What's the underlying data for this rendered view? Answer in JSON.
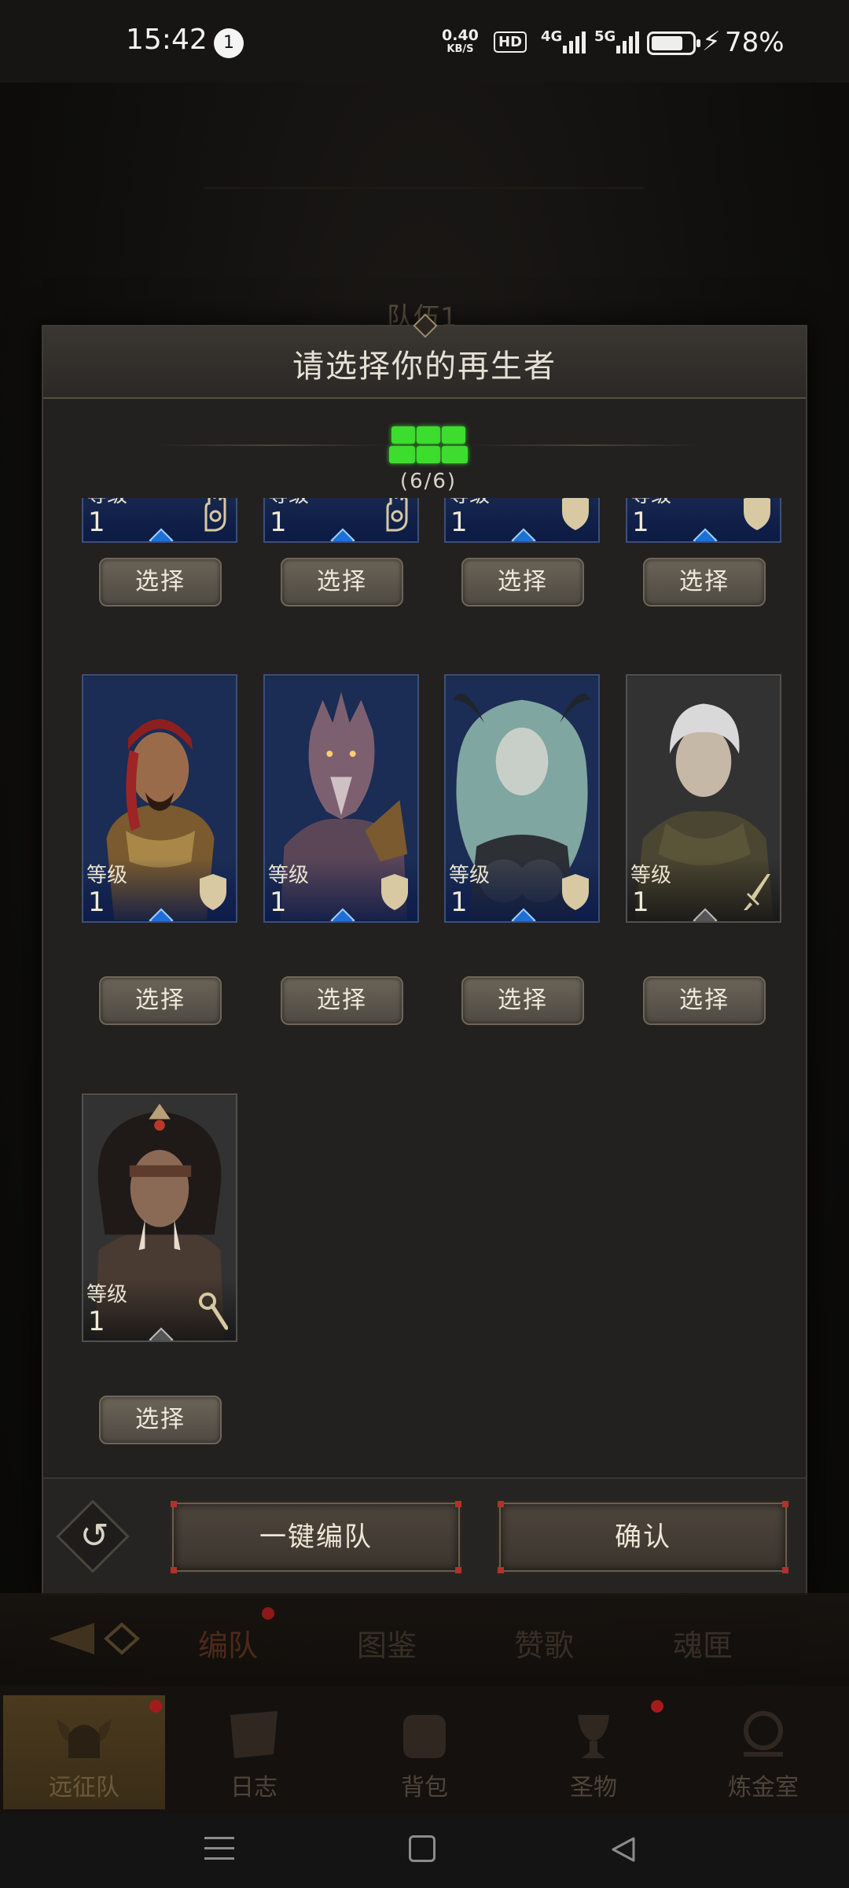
{
  "status_bar": {
    "time": "15:42",
    "notification_count": "1",
    "net_speed_value": "0.40",
    "net_speed_unit": "KB/S",
    "hd_label": "HD",
    "signal_1": "4G",
    "signal_2": "5G",
    "battery_percent": "78%",
    "battery_level": 0.78
  },
  "background": {
    "team_label": "队伍1"
  },
  "modal": {
    "title": "请选择你的再生者",
    "counter": "(6/6)",
    "level_label": "等级",
    "select_label": "选择",
    "heroes_top_row": [
      {
        "level": "1",
        "class_icon": "hand-icon",
        "rarity": "blue"
      },
      {
        "level": "1",
        "class_icon": "hand-icon",
        "rarity": "blue"
      },
      {
        "level": "1",
        "class_icon": "shield-icon",
        "rarity": "blue"
      },
      {
        "level": "1",
        "class_icon": "shield-icon",
        "rarity": "blue"
      }
    ],
    "heroes_mid_row": [
      {
        "level": "1",
        "class_icon": "shield-icon",
        "rarity": "blue",
        "portrait": "pirate-warrior"
      },
      {
        "level": "1",
        "class_icon": "shield-icon",
        "rarity": "blue",
        "portrait": "dragonkin"
      },
      {
        "level": "1",
        "class_icon": "shield-icon",
        "rarity": "blue",
        "portrait": "horned-elf"
      },
      {
        "level": "1",
        "class_icon": "sword-icon",
        "rarity": "grey",
        "portrait": "silver-haired-elf"
      }
    ],
    "heroes_bottom_row": [
      {
        "level": "1",
        "class_icon": "staff-icon",
        "rarity": "grey",
        "portrait": "tribal-shaman"
      }
    ],
    "auto_team_label": "一键编队",
    "confirm_label": "确认"
  },
  "subnav": {
    "tabs": [
      "编队",
      "图鉴",
      "赞歌",
      "魂匣"
    ]
  },
  "main_nav": {
    "items": [
      "远征队",
      "日志",
      "背包",
      "圣物",
      "炼金室"
    ]
  },
  "colors": {
    "accent_green": "#3ddc2e",
    "rarity_blue": "#1c2d52",
    "alert_red": "#a51b1b"
  }
}
